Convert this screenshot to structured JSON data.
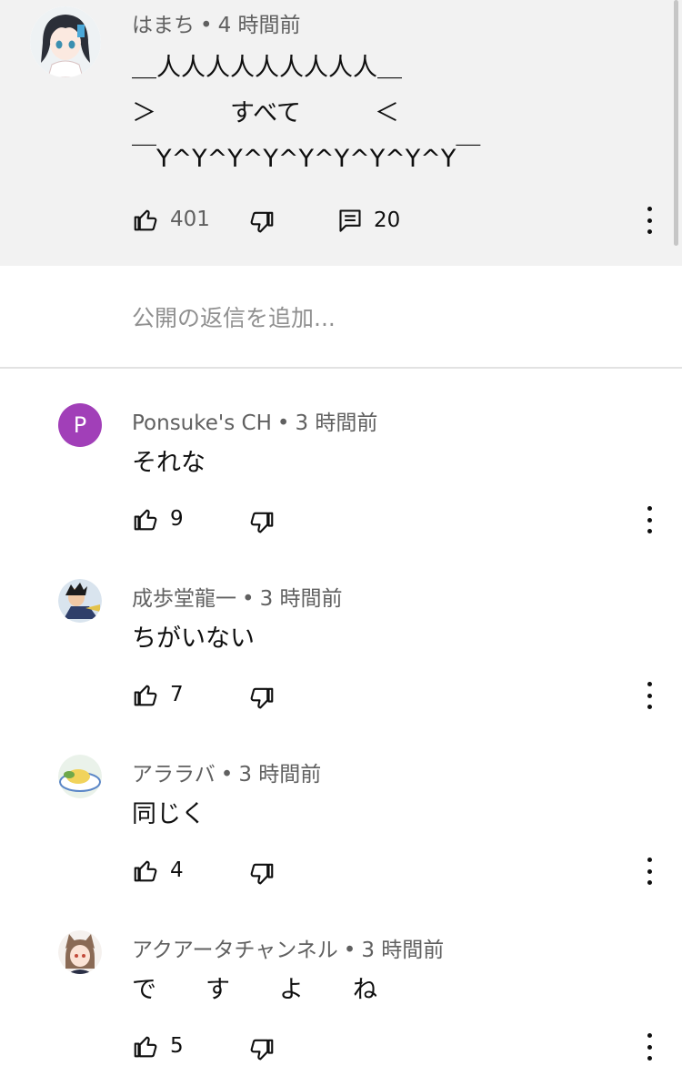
{
  "top_comment": {
    "author": "はまち",
    "time": "4 時間前",
    "lines": [
      "＿人人人人人人人人人＿",
      "＞　　　すべて　　　＜",
      "￣Y^Y^Y^Y^Y^Y^Y^Y^Y￣"
    ],
    "likes": "401",
    "replies": "20"
  },
  "reply_placeholder": "公開の返信を追加...",
  "replies": [
    {
      "author": "Ponsuke's CH",
      "time": "3 時間前",
      "text": "それな",
      "likes": "9",
      "initial": "P"
    },
    {
      "author": "成歩堂龍一",
      "time": "3 時間前",
      "text": "ちがいない",
      "likes": "7"
    },
    {
      "author": "アララバ",
      "time": "3 時間前",
      "text": "同じく",
      "likes": "4"
    },
    {
      "author": "アクアータチャンネル",
      "time": "3 時間前",
      "text": "で　　す　　よ　　ね",
      "likes": "5"
    }
  ],
  "icons": [
    "thumb-up-icon",
    "thumb-down-icon",
    "reply-icon",
    "more-vert-icon"
  ]
}
